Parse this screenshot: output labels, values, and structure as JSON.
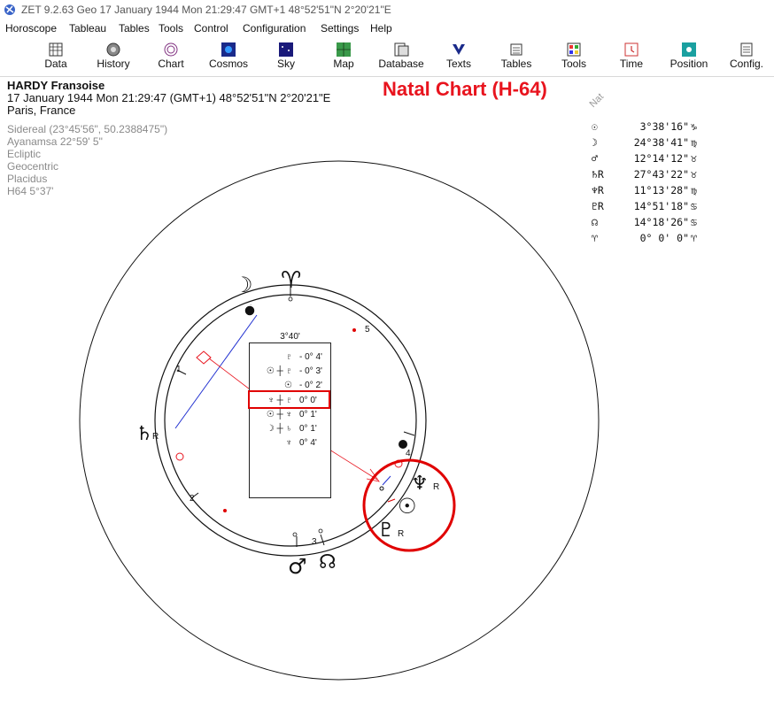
{
  "window": {
    "title": "ZET 9.2.63 Geo    17 January 1944  Mon  21:29:47 GMT+1 48°52'51\"N  2°20'21\"E"
  },
  "menu": [
    "Horoscope",
    "Tableau",
    "Tables",
    "Tools",
    "Control",
    "Configuration",
    "Settings",
    "Help"
  ],
  "toolbar": [
    {
      "label": "Data",
      "icon": "data-icon"
    },
    {
      "label": "History",
      "icon": "history-icon"
    },
    {
      "label": "Chart",
      "icon": "chart-icon"
    },
    {
      "label": "Cosmos",
      "icon": "cosmos-icon"
    },
    {
      "label": "Sky",
      "icon": "sky-icon"
    },
    {
      "label": "Map",
      "icon": "map-icon"
    },
    {
      "label": "Database",
      "icon": "database-icon"
    },
    {
      "label": "Texts",
      "icon": "texts-icon"
    },
    {
      "label": "Tables",
      "icon": "tables-icon"
    },
    {
      "label": "Tools",
      "icon": "tools-icon"
    },
    {
      "label": "Time",
      "icon": "time-icon"
    },
    {
      "label": "Position",
      "icon": "position-icon"
    },
    {
      "label": "Config.",
      "icon": "config-icon"
    }
  ],
  "person": {
    "name": "HARDY Franзoise",
    "datetime": "17 January 1944  Mon  21:29:47 (GMT+1) 48°52'51\"N  2°20'21\"E",
    "place": "Paris, France"
  },
  "settings": [
    "Sidereal (23°45'56\", 50.2388475\")",
    "Ayanamsa 22°59' 5\"",
    "Ecliptic",
    "Geocentric",
    "Placidus",
    "H64   5°37'"
  ],
  "heading": "Natal Chart (H-64)",
  "nat_label": "Nat",
  "planets": [
    {
      "glyph": "☉",
      "value": "3°38'16\"",
      "sign": "♑"
    },
    {
      "glyph": "☽",
      "value": "24°38'41\"",
      "sign": "♍"
    },
    {
      "glyph": "♂",
      "value": "12°14'12\"",
      "sign": "♉"
    },
    {
      "glyph": "♄R",
      "value": "27°43'22\"",
      "sign": "♉"
    },
    {
      "glyph": "♆R",
      "value": "11°13'28\"",
      "sign": "♍"
    },
    {
      "glyph": "♇R",
      "value": "14°51'18\"",
      "sign": "♋"
    },
    {
      "glyph": "☊",
      "value": "14°18'26\"",
      "sign": "♋"
    },
    {
      "glyph": "♈",
      "value": "0° 0' 0\"",
      "sign": "♈"
    }
  ],
  "midpoints": {
    "header": "3°40'",
    "rows": [
      {
        "glyph": "♇",
        "value": "- 0° 4'"
      },
      {
        "glyph": "☉ ┼ ♇",
        "value": "- 0° 3'"
      },
      {
        "glyph": "☉",
        "value": "- 0° 2'"
      },
      {
        "glyph": "♆ ┼ ♇",
        "value": "0° 0'"
      },
      {
        "glyph": "☉ ┼ ♆",
        "value": "0° 1'"
      },
      {
        "glyph": "☽ ┼ ♄",
        "value": "0° 1'"
      },
      {
        "glyph": "♆",
        "value": "0° 4'"
      }
    ]
  },
  "chart_glyphs": {
    "aries": "♈",
    "moon": "☽",
    "saturn": "♄",
    "mars": "♂",
    "node": "☊",
    "neptune": "♆",
    "sun": "☉",
    "pluto": "♇",
    "retro": "R"
  },
  "house_labels": [
    "1",
    "2",
    "3",
    "4",
    "5"
  ],
  "colors": {
    "accent_red": "#e8141e",
    "aspect_blue": "#2030d0",
    "highlight_red": "#e00000"
  }
}
